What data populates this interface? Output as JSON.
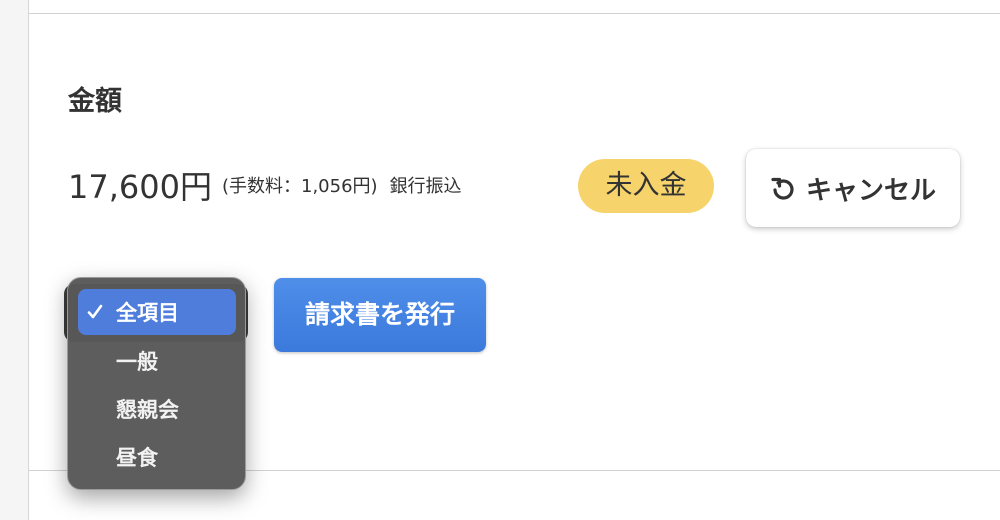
{
  "section": {
    "title": "金額"
  },
  "payment": {
    "amount": "17,600円",
    "fee": "(手数料：1,056円)",
    "method": "銀行振込",
    "status": "未入金"
  },
  "actions": {
    "cancel_label": "キャンセル",
    "issue_invoice_label": "請求書を発行"
  },
  "category_select": {
    "options": [
      "全項目",
      "一般",
      "懇親会",
      "昼食"
    ],
    "selected": "全項目"
  },
  "colors": {
    "status_badge": "#f6d36b",
    "primary_button": "#3b79dc",
    "menu_highlight": "#4f7ddc",
    "menu_background": "#585858"
  },
  "icons": {
    "cancel": "undo-icon",
    "selected_option": "checkmark-icon"
  }
}
